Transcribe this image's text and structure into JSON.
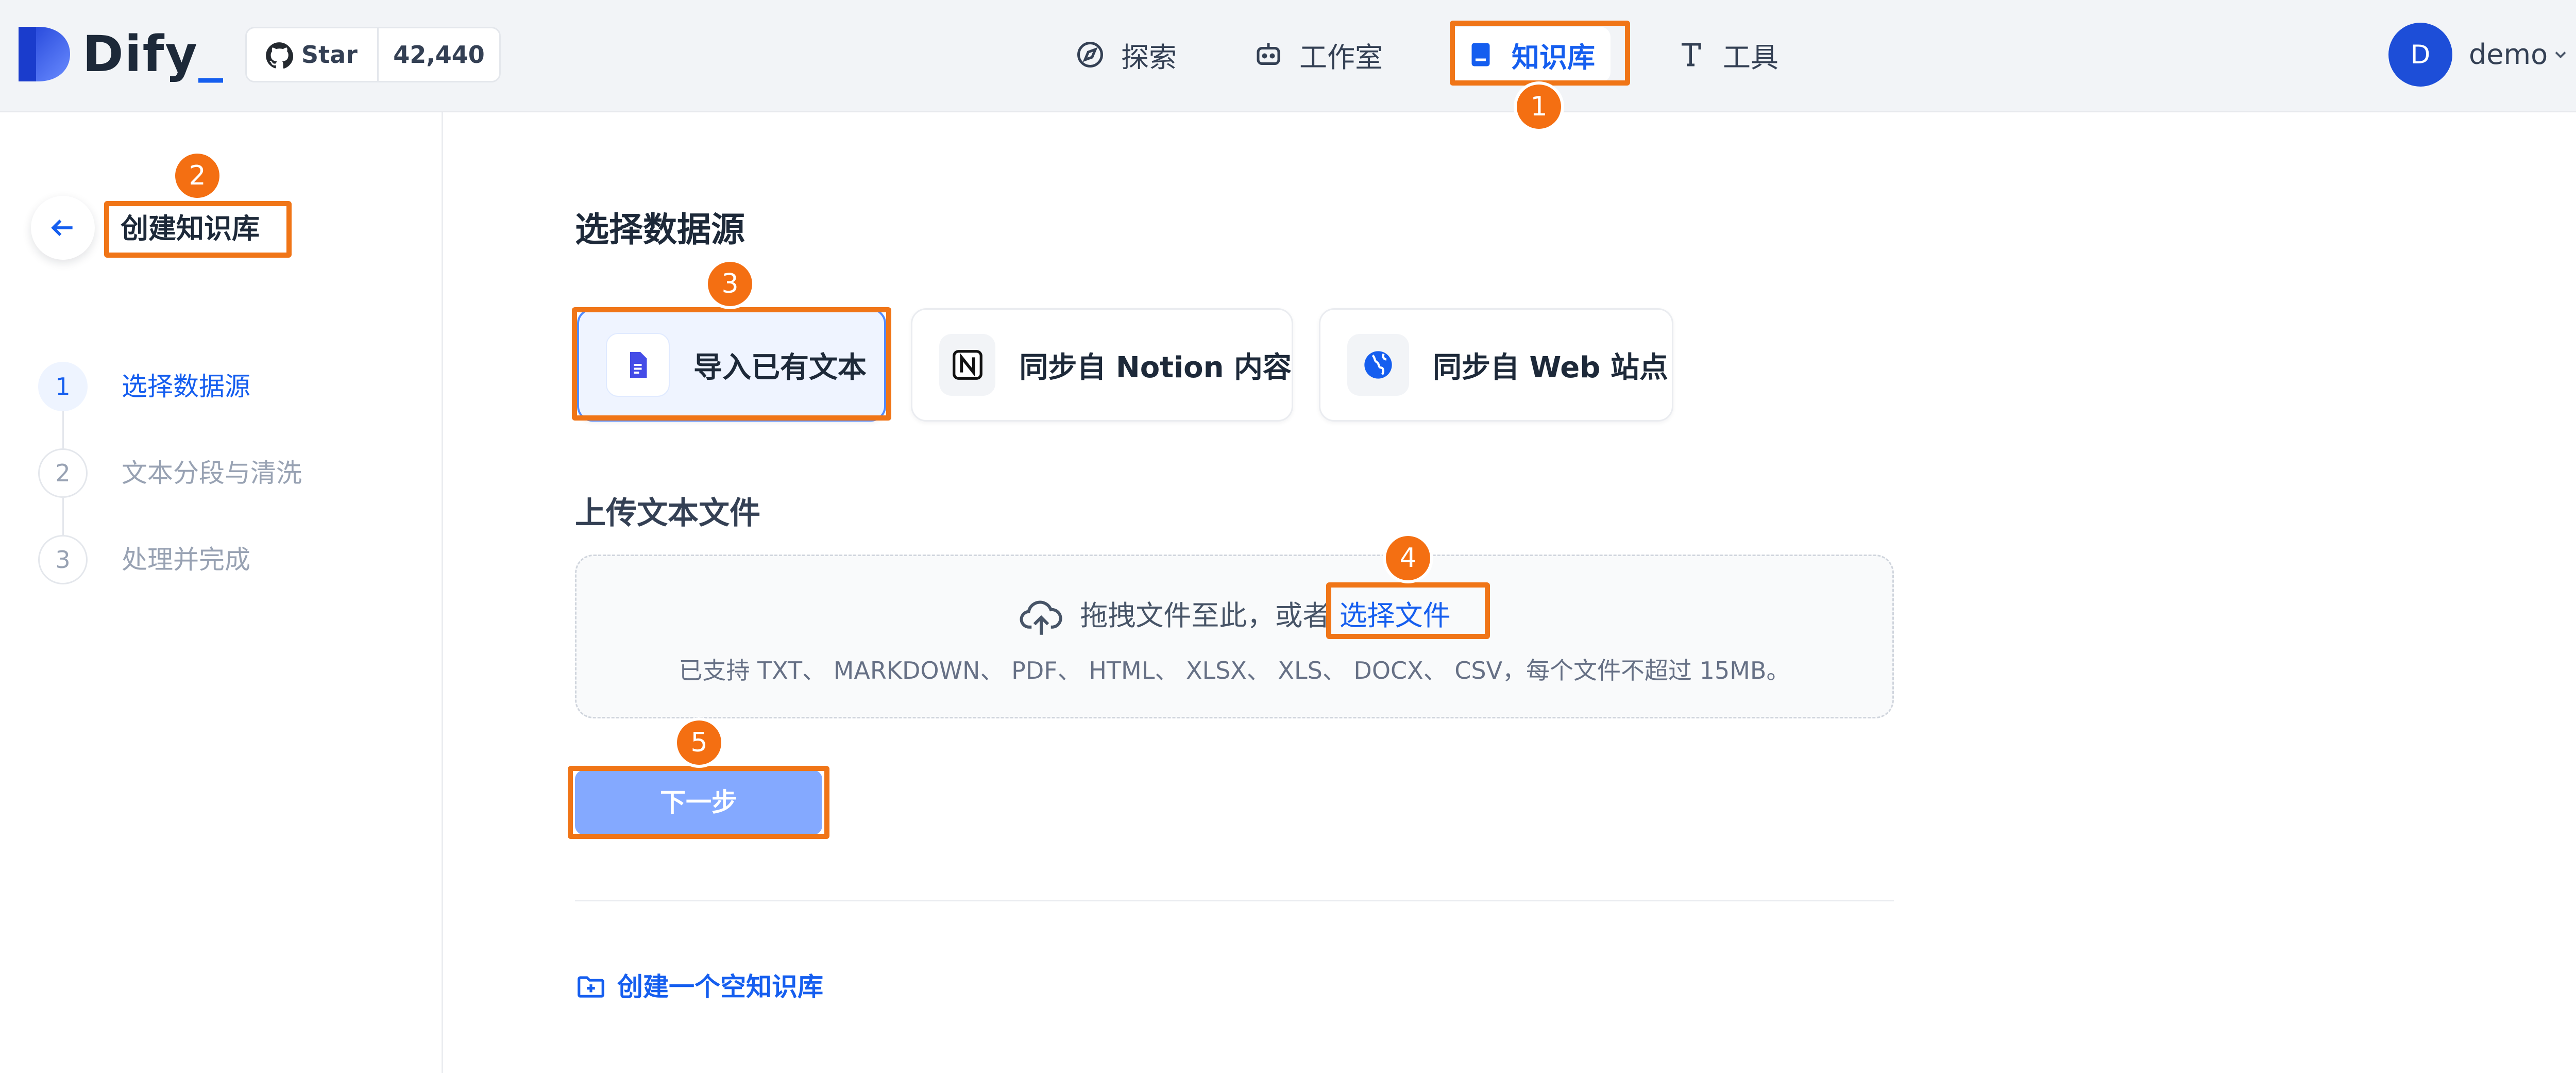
{
  "app": {
    "logo_text": "Dify",
    "logo_accent": "_"
  },
  "github": {
    "star_label": "Star",
    "star_count": "42,440",
    "icon": "github-icon"
  },
  "nav": [
    {
      "label": "探索",
      "icon": "compass-icon",
      "active": false
    },
    {
      "label": "工作室",
      "icon": "robot-icon",
      "active": false
    },
    {
      "label": "知识库",
      "icon": "book-icon",
      "active": true
    },
    {
      "label": "工具",
      "icon": "tool-icon",
      "active": false
    }
  ],
  "user": {
    "avatar_initial": "D",
    "name": "demo",
    "icon": "chevron-down-icon"
  },
  "sidebar": {
    "title": "创建知识库",
    "back_icon": "arrow-left-icon",
    "steps": [
      {
        "number": "1",
        "label": "选择数据源",
        "active": true
      },
      {
        "number": "2",
        "label": "文本分段与清洗",
        "active": false
      },
      {
        "number": "3",
        "label": "处理并完成",
        "active": false
      }
    ]
  },
  "main": {
    "title": "选择数据源",
    "sources": [
      {
        "label": "导入已有文本",
        "icon": "document-icon",
        "active": true
      },
      {
        "label": "同步自 Notion 内容",
        "icon": "notion-icon",
        "active": false
      },
      {
        "label": "同步自 Web 站点",
        "icon": "globe-icon",
        "active": false
      }
    ],
    "upload_title": "上传文本文件",
    "dropzone": {
      "text": "拖拽文件至此，或者",
      "link": "选择文件",
      "hint": "已支持 TXT、 MARKDOWN、 PDF、 HTML、 XLSX、 XLS、 DOCX、 CSV，每个文件不超过 15MB。",
      "icon": "cloud-upload-icon"
    },
    "next_button": "下一步",
    "empty_link": "创建一个空知识库",
    "empty_icon": "folder-plus-icon"
  },
  "annotations": [
    "1",
    "2",
    "3",
    "4",
    "5"
  ],
  "colors": {
    "primary": "#155eef",
    "annotation": "#f07517",
    "next_button": "#84a9ff"
  }
}
